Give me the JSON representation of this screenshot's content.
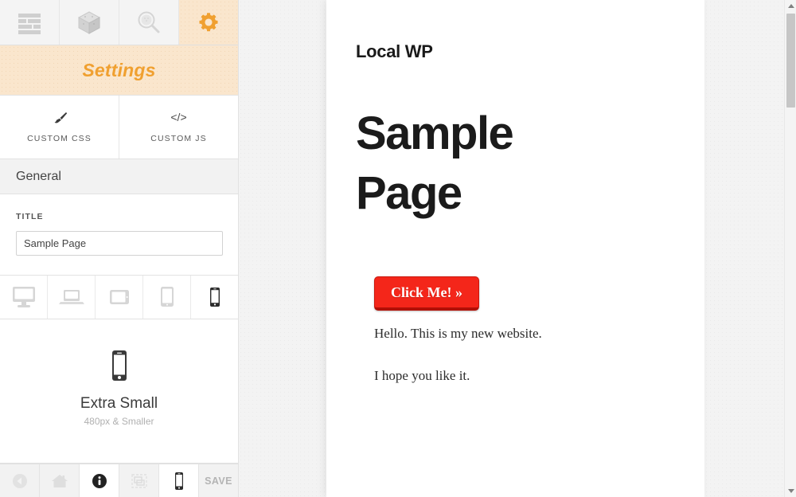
{
  "left_panel": {
    "top_tabs": [
      {
        "name": "content-tab",
        "icon": "lines-icon",
        "active": false
      },
      {
        "name": "modules-tab",
        "icon": "cube-icon",
        "active": false
      },
      {
        "name": "search-tab",
        "icon": "magnifier-icon",
        "active": false
      },
      {
        "name": "settings-tab",
        "icon": "gear-icon",
        "active": true
      }
    ],
    "panel_title": "Settings",
    "code_tabs": [
      {
        "glyph": "brush",
        "label": "CUSTOM CSS"
      },
      {
        "glyph": "code",
        "label": "CUSTOM JS"
      }
    ],
    "section_header": "General",
    "title_field": {
      "label": "TITLE",
      "value": "Sample Page",
      "placeholder": "Sample Page"
    },
    "devices": [
      {
        "name": "desktop",
        "active": false
      },
      {
        "name": "laptop",
        "active": false
      },
      {
        "name": "tablet-landscape",
        "active": false
      },
      {
        "name": "tablet-portrait",
        "active": false
      },
      {
        "name": "phone",
        "active": true
      }
    ],
    "breakpoint": {
      "icon": "phone-icon",
      "name": "Extra Small",
      "range": "480px & Smaller"
    },
    "bottom_bar": {
      "items": [
        {
          "name": "back-icon",
          "active": false
        },
        {
          "name": "home-icon",
          "active": false
        },
        {
          "name": "info-icon",
          "active": true
        },
        {
          "name": "layout-icon",
          "active": false
        },
        {
          "name": "phone-icon",
          "active": true
        }
      ],
      "save_label": "SAVE"
    }
  },
  "preview": {
    "site_title": "Local WP",
    "page_heading": "Sample Page",
    "cta_label": "Click Me! »",
    "paragraphs": [
      "Hello. This is my new website.",
      "I hope you like it."
    ]
  },
  "colors": {
    "accent_orange": "#f0a030",
    "settings_bg": "#fae6cd",
    "cta_red": "#f4261a",
    "cta_red_dark": "#b21007",
    "panel_gray": "#f2f2f2"
  }
}
